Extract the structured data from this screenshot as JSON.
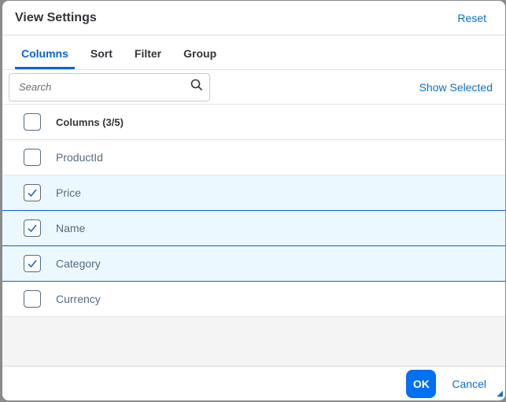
{
  "dialog": {
    "title": "View Settings",
    "reset_label": "Reset"
  },
  "tabs": [
    {
      "label": "Columns"
    },
    {
      "label": "Sort"
    },
    {
      "label": "Filter"
    },
    {
      "label": "Group"
    }
  ],
  "toolbar": {
    "search_placeholder": "Search",
    "show_selected_label": "Show Selected"
  },
  "list": {
    "header": "Columns (3/5)",
    "items": [
      {
        "label": "ProductId",
        "checked": false
      },
      {
        "label": "Price",
        "checked": true
      },
      {
        "label": "Name",
        "checked": true
      },
      {
        "label": "Category",
        "checked": true
      },
      {
        "label": "Currency",
        "checked": false
      }
    ]
  },
  "footer": {
    "ok_label": "OK",
    "cancel_label": "Cancel"
  }
}
